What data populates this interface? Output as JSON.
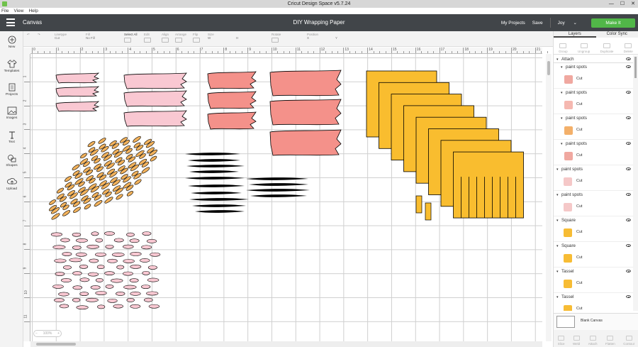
{
  "window": {
    "title": "Cricut Design Space  v5.7.24",
    "controls": [
      "—",
      "☐",
      "✕"
    ]
  },
  "menu": [
    "File",
    "View",
    "Help"
  ],
  "header": {
    "canvas_label": "Canvas",
    "project_name": "DIY Wrapping Paper",
    "my_projects": "My Projects",
    "save": "Save",
    "user": "Joy",
    "make_it": "Make It"
  },
  "toolbar": {
    "linetype": "Linetype",
    "linetype_value": "Cut",
    "fill": "Fill",
    "fill_value": "No Fill",
    "select_all": "Select All",
    "edit": "Edit",
    "align": "Align",
    "arrange": "Arrange",
    "flip": "Flip",
    "size": "Size",
    "w": "W",
    "h": "H",
    "rotate": "Rotate",
    "position": "Position",
    "x": "X",
    "y": "Y"
  },
  "sidebar": [
    {
      "label": "New",
      "icon": "plus-circle-icon"
    },
    {
      "label": "Templates",
      "icon": "shirt-icon"
    },
    {
      "label": "Projects",
      "icon": "projects-icon"
    },
    {
      "label": "Images",
      "icon": "image-icon"
    },
    {
      "label": "Text",
      "icon": "text-icon"
    },
    {
      "label": "Shapes",
      "icon": "shapes-icon"
    },
    {
      "label": "Upload",
      "icon": "upload-icon"
    }
  ],
  "ruler": {
    "top": [
      "0",
      "1",
      "2",
      "3",
      "4",
      "5",
      "6",
      "7",
      "8",
      "9",
      "10",
      "11",
      "12",
      "13",
      "14",
      "15",
      "16",
      "17",
      "18",
      "19",
      "20",
      "21"
    ],
    "left": [
      "1",
      "2",
      "3",
      "4",
      "5",
      "6",
      "7",
      "8",
      "9",
      "10",
      "11"
    ]
  },
  "zoom": {
    "minus": "−",
    "value": "100%",
    "plus": "+"
  },
  "panel": {
    "tabs": [
      "Layers",
      "Color Sync"
    ],
    "actions": [
      "Group",
      "Ungroup",
      "Duplicate",
      "Delete"
    ],
    "attach_label": "Attach",
    "layers": [
      {
        "name": "paint spots",
        "op": "Cut",
        "color": "#f0a8a0",
        "nested": true
      },
      {
        "name": "paint spots",
        "op": "Cut",
        "color": "#f5b8b0",
        "nested": true
      },
      {
        "name": "paint spots",
        "op": "Cut",
        "color": "#f3b06a",
        "nested": true
      },
      {
        "name": "paint spots",
        "op": "Cut",
        "color": "#f0a8a0",
        "nested": true
      },
      {
        "name": "paint spots",
        "op": "Cut",
        "color": "#f5c8c8",
        "nested": false
      },
      {
        "name": "paint spots",
        "op": "Cut",
        "color": "#f5c8c8",
        "nested": false
      },
      {
        "name": "Square",
        "op": "Cut",
        "color": "#f7bc34",
        "nested": false
      },
      {
        "name": "Square",
        "op": "Cut",
        "color": "#f7bc34",
        "nested": false
      },
      {
        "name": "Tassel",
        "op": "Cut",
        "color": "#f7bc34",
        "nested": false
      },
      {
        "name": "Tassel",
        "op": "Cut",
        "color": "#f7bc34",
        "nested": false
      }
    ],
    "blank_canvas": "Blank Canvas",
    "bottom_actions": [
      "Slice",
      "Weld",
      "Attach",
      "Flatten",
      "Contour"
    ]
  },
  "colors": {
    "pink_light": "#f9c8d2",
    "salmon": "#f4918a",
    "orange": "#f2b25c",
    "yellow": "#f9bd2f",
    "black": "#000000",
    "green": "#51b748"
  }
}
